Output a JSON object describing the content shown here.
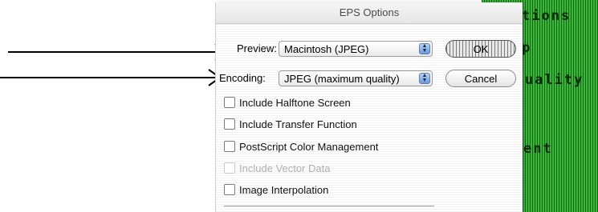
{
  "dialog": {
    "title": "EPS Options",
    "preview": {
      "label": "Preview:",
      "value": "Macintosh  (JPEG)"
    },
    "encoding": {
      "label": "Encoding:",
      "value": "JPEG  (maximum quality)"
    },
    "buttons": {
      "ok": "OK",
      "cancel": "Cancel"
    },
    "options": [
      {
        "label": "Include Halftone Screen",
        "checked": false,
        "enabled": true
      },
      {
        "label": "Include Transfer Function",
        "checked": false,
        "enabled": true
      },
      {
        "label": "PostScript Color Management",
        "checked": false,
        "enabled": true
      },
      {
        "label": "Include Vector Data",
        "checked": false,
        "enabled": false
      },
      {
        "label": "Image Interpolation",
        "checked": false,
        "enabled": true
      }
    ]
  },
  "background_fragments": [
    "tions",
    "p",
    "uality",
    "ent"
  ],
  "colors": {
    "background_stripe": "#3fb53f",
    "stepper": "#6a9ad6"
  }
}
